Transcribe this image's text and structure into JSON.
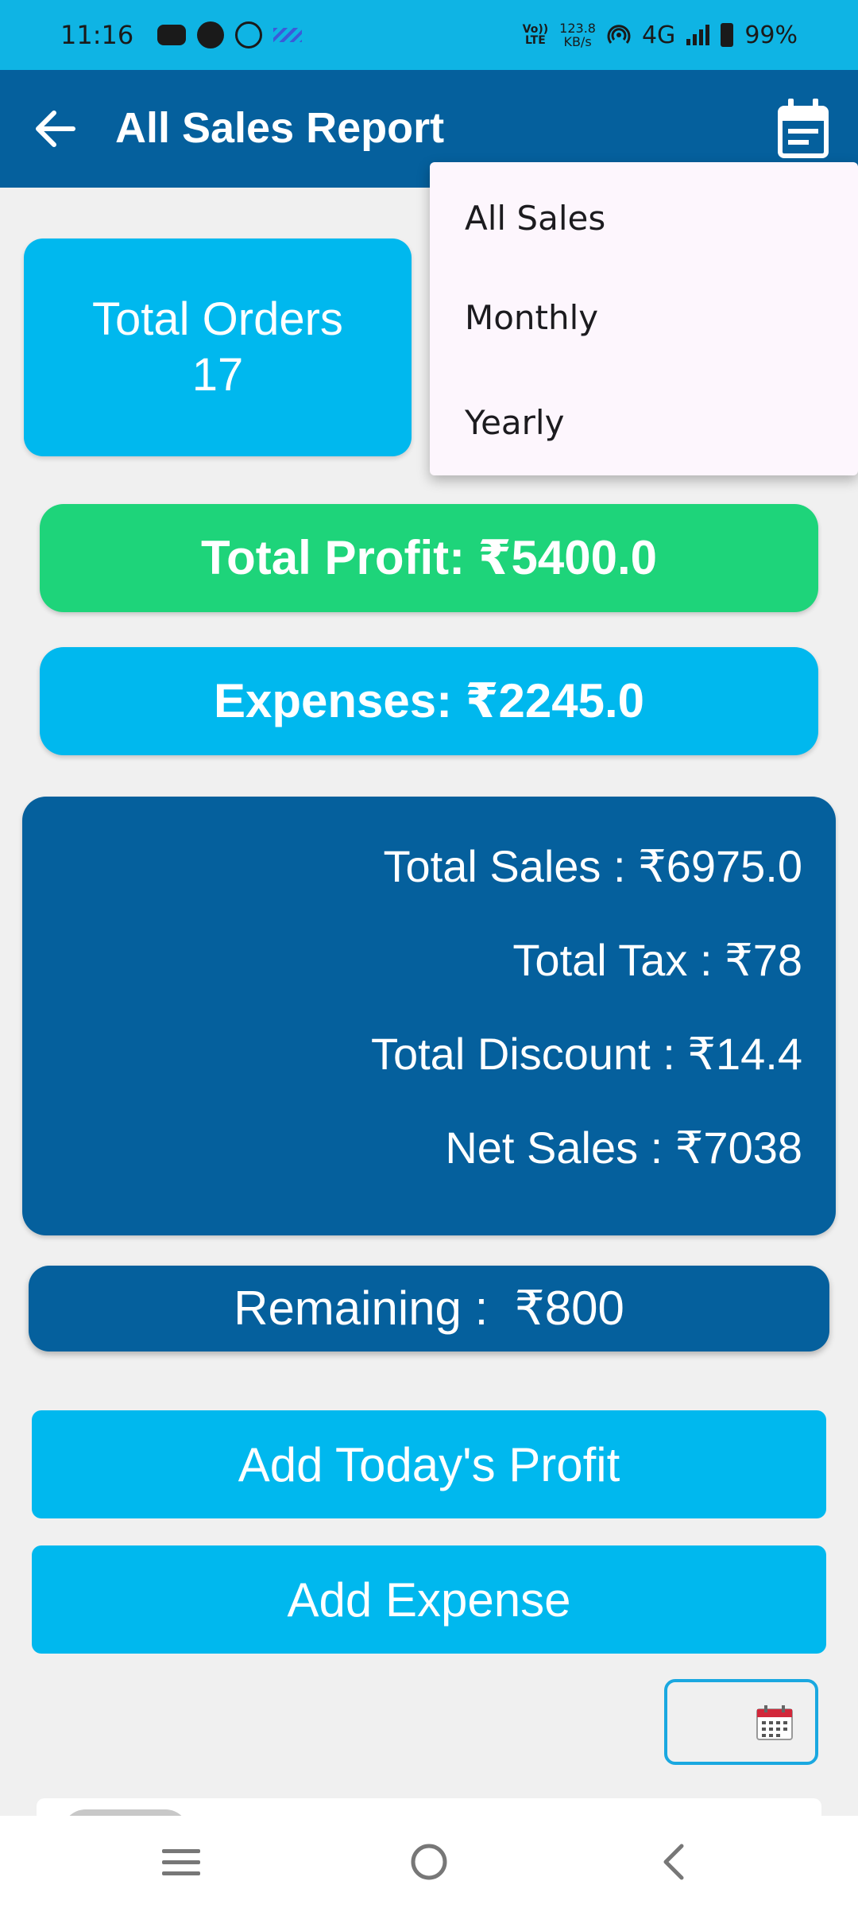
{
  "status_bar": {
    "time": "11:16",
    "volte": "Vo))",
    "lte": "LTE",
    "speed_value": "123.8",
    "speed_unit": "KB/s",
    "network": "4G",
    "battery": "99%"
  },
  "app_bar": {
    "title": "All Sales Report",
    "back_icon": "arrow-back-icon",
    "menu_icon": "calendar-icon"
  },
  "orders": {
    "label": "Total Orders",
    "count": "17"
  },
  "profit": {
    "text": "Total Profit: ₹5400.0"
  },
  "expenses": {
    "text": "Expenses: ₹2245.0"
  },
  "summary": {
    "total_sales": "Total Sales : ₹6975.0",
    "total_tax": "Total Tax : ₹78",
    "total_discount": "Total Discount : ₹14.4",
    "net_sales": "Net Sales : ₹7038"
  },
  "remaining": {
    "text": "Remaining :  ₹800"
  },
  "actions": {
    "add_profit": "Add Today's Profit",
    "add_expense": "Add Expense"
  },
  "dropdown": {
    "items": [
      "All Sales",
      "Monthly",
      "Yearly"
    ]
  },
  "colors": {
    "status_bar": "#0fb4e4",
    "primary_dark": "#05609d",
    "accent": "#00b8ee",
    "profit_green": "#1ed47a"
  }
}
